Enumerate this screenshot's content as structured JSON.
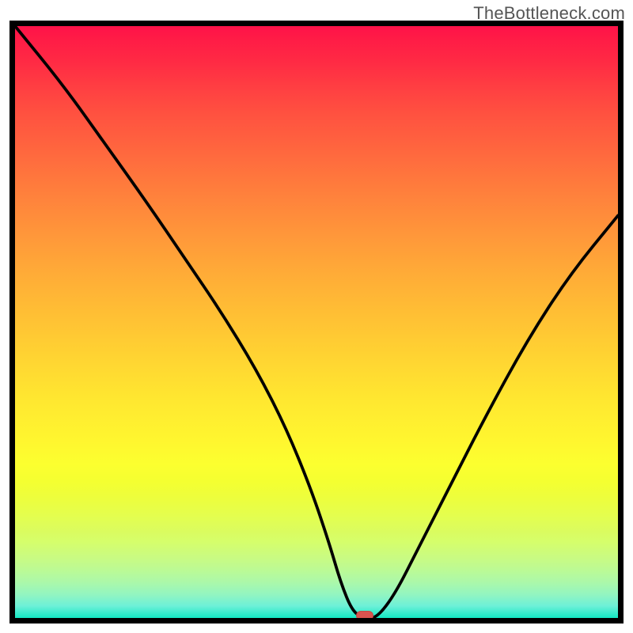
{
  "watermark": "TheBottleneck.com",
  "chart_data": {
    "type": "line",
    "title": "",
    "xlabel": "",
    "ylabel": "",
    "xlim": [
      0,
      100
    ],
    "ylim": [
      0,
      100
    ],
    "grid": false,
    "series": [
      {
        "name": "curve",
        "x": [
          0,
          8,
          15,
          22,
          28,
          34,
          40,
          45,
          49,
          52,
          54,
          56,
          58,
          60,
          63,
          67,
          72,
          78,
          85,
          92,
          100
        ],
        "values": [
          100,
          90,
          80,
          70,
          61,
          52,
          42,
          32,
          22,
          13,
          6,
          1,
          0,
          0,
          4,
          12,
          22,
          34,
          47,
          58,
          68
        ]
      }
    ],
    "marker": {
      "x": 58,
      "y": 0
    },
    "gradient_stops": [
      {
        "pos": 0,
        "color": "#ff1249"
      },
      {
        "pos": 50,
        "color": "#ffd432"
      },
      {
        "pos": 75,
        "color": "#f4ff31"
      },
      {
        "pos": 100,
        "color": "#13e8c3"
      }
    ]
  }
}
